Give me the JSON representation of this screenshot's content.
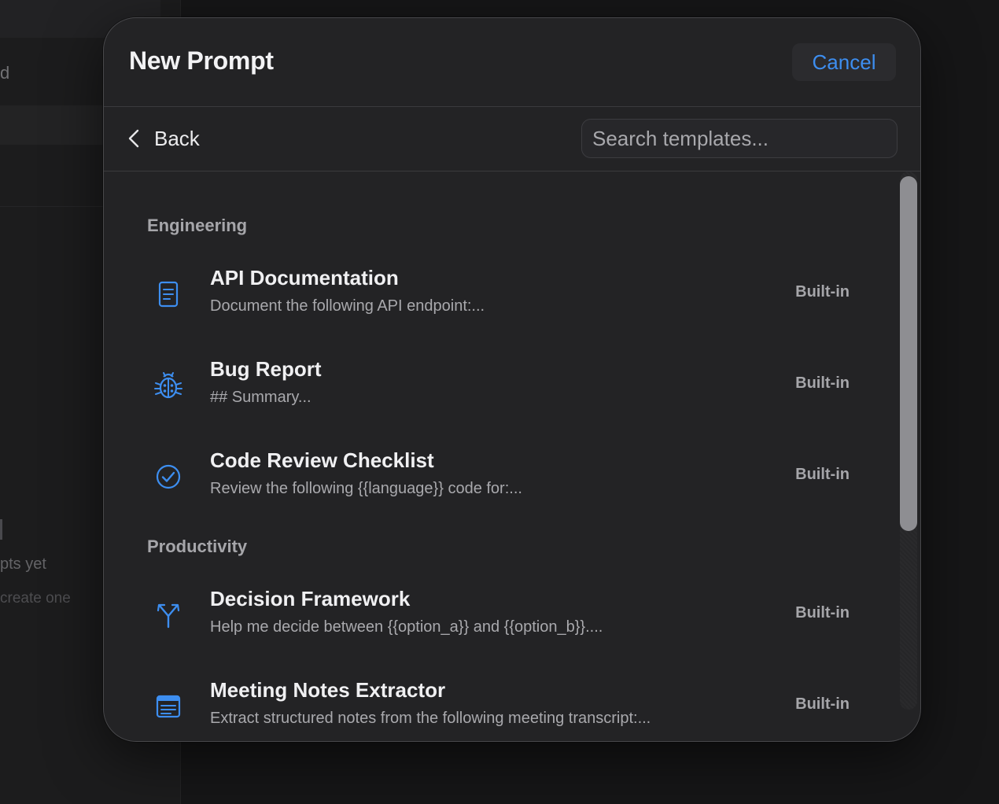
{
  "background": {
    "sidebar_fragment_1": "d",
    "sidebar_fragment_2": "pts yet",
    "sidebar_fragment_3": "create one"
  },
  "modal": {
    "title": "New Prompt",
    "cancel_label": "Cancel"
  },
  "toolbar": {
    "back_label": "Back",
    "search_placeholder": "Search templates...",
    "search_value": ""
  },
  "sections": [
    {
      "name": "Engineering",
      "templates": [
        {
          "title": "API Documentation",
          "description": "Document the following API endpoint:...",
          "badge": "Built-in",
          "icon": "document-icon"
        },
        {
          "title": "Bug Report",
          "description": "## Summary...",
          "badge": "Built-in",
          "icon": "bug-icon"
        },
        {
          "title": "Code Review Checklist",
          "description": "Review the following {{language}} code for:...",
          "badge": "Built-in",
          "icon": "checkmark-circle-icon"
        }
      ]
    },
    {
      "name": "Productivity",
      "templates": [
        {
          "title": "Decision Framework",
          "description": "Help me decide between {{option_a}} and {{option_b}}....",
          "badge": "Built-in",
          "icon": "branch-icon"
        },
        {
          "title": "Meeting Notes Extractor",
          "description": "Extract structured notes from the following meeting transcript:...",
          "badge": "Built-in",
          "icon": "notes-window-icon"
        }
      ]
    }
  ],
  "colors": {
    "accent": "#3d8ef0",
    "modal_bg": "#232325",
    "muted_text": "#a6a6aa"
  }
}
